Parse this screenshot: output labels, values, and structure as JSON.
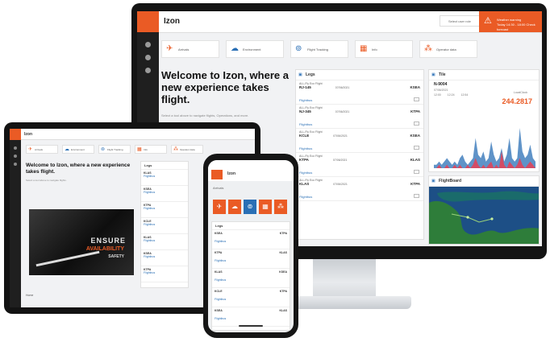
{
  "desktop": {
    "app_title": "Izon",
    "header_select": "Select user role",
    "alert": {
      "line1": "Weather warning",
      "line2": "Today 14:30 - 18:00 Check forecast"
    },
    "quick_actions": [
      {
        "label": "Arrivals",
        "icon": "plane-arrival-icon",
        "glyph": "✈",
        "color": "#ea5b25"
      },
      {
        "label": "Environment",
        "icon": "cloud-icon",
        "glyph": "☁",
        "color": "#2a6fb5"
      },
      {
        "label": "Flight Tracking",
        "icon": "satellite-icon",
        "glyph": "⊚",
        "color": "#2a6fb5"
      },
      {
        "label": "Info",
        "icon": "info-board-icon",
        "glyph": "▦",
        "color": "#ea5b25"
      },
      {
        "label": "Operator data",
        "icon": "network-icon",
        "glyph": "⁂",
        "color": "#ea5b25"
      }
    ],
    "welcome_heading": "Welcome to Izon, where a new experience takes flight.",
    "welcome_text": "Select a tool above to navigate flights, Operations, and more.",
    "legs_panel": {
      "title": "Legs",
      "rows": [
        {
          "code": "ALL-Fly Eco Flight",
          "flight": "RJ-145",
          "time": "07/06/2021",
          "dest": "KSEA",
          "status": "Flightbus"
        },
        {
          "code": "ALL-Fly Eco Flight",
          "flight": "NJ-345",
          "time": "07/06/2021",
          "dest": "KTPA",
          "status": "Flightbus"
        },
        {
          "code": "ALL-Fly Eco Flight",
          "flight": "KCLE",
          "time": "07/06/2021",
          "dest": "KSEA",
          "status": "Flightbus"
        },
        {
          "code": "ALL-Fly Eco Flight",
          "flight": "KTPA",
          "time": "07/06/2021",
          "dest": "KLAS",
          "status": "Flightbus"
        },
        {
          "code": "ALL-Fly Eco Flight",
          "flight": "KLAS",
          "time": "07/06/2021",
          "dest": "KTPA",
          "status": "Flightbus"
        }
      ]
    },
    "tile_panel": {
      "title": "Tile",
      "route": "N-9004",
      "date": "07/06/2021",
      "date_label": "LocalClock",
      "kpi": "244.2817",
      "times": [
        "12:00",
        "12:24",
        "12:54"
      ]
    },
    "map_panel": {
      "title": "FlightBoard"
    },
    "chart_data": {
      "type": "area",
      "series": [
        {
          "values": [
            1,
            1,
            2,
            1,
            2,
            3,
            2,
            1,
            2,
            1,
            3,
            4,
            2,
            1,
            2,
            3,
            9,
            4,
            3,
            5,
            2,
            3,
            8,
            4,
            2,
            3,
            6,
            2,
            4,
            9,
            3,
            2,
            3,
            12,
            5,
            3,
            4,
            7,
            3,
            2
          ],
          "color": "#2a6fb5"
        },
        {
          "values": [
            0,
            0,
            1,
            0,
            0,
            1,
            0,
            0,
            1,
            0,
            1,
            0,
            0,
            1,
            0,
            1,
            3,
            1,
            0,
            1,
            0,
            1,
            2,
            0,
            1,
            0,
            5,
            1,
            0,
            2,
            1,
            0,
            1,
            3,
            1,
            0,
            1,
            2,
            1,
            0
          ],
          "color": "#e0455a"
        }
      ]
    }
  },
  "tablet": {
    "app_title": "Izon",
    "quick_actions": [
      {
        "label": "Arrivals",
        "glyph": "✈",
        "color": "#ea5b25"
      },
      {
        "label": "Environment",
        "glyph": "☁",
        "color": "#2a6fb5"
      },
      {
        "label": "Flight Tracking",
        "glyph": "⊚",
        "color": "#2a6fb5"
      },
      {
        "label": "Info",
        "glyph": "▦",
        "color": "#ea5b25"
      },
      {
        "label": "Operator data",
        "glyph": "⁂",
        "color": "#ea5b25"
      }
    ],
    "welcome_heading": "Welcome to Izon, where a new experience takes flight.",
    "welcome_text": "Select a tool above to navigate flights.",
    "video_title": "ENSURE",
    "video_line1": "AVAILABILITY",
    "video_line2": "SAFETY",
    "legs_title": "Legs",
    "footer": "Home",
    "rows": [
      {
        "flight": "KLAS",
        "status": "Flightbus"
      },
      {
        "flight": "KSEA",
        "status": "Flightbus"
      },
      {
        "flight": "KTPA",
        "status": "Flightbus"
      },
      {
        "flight": "KCLE",
        "status": "Flightbus"
      },
      {
        "flight": "KLAS",
        "status": "Flightbus"
      },
      {
        "flight": "KSEA",
        "status": "Flightbus"
      },
      {
        "flight": "KTPA",
        "status": "Flightbus"
      }
    ]
  },
  "phone": {
    "app_title": "Izon",
    "subtitle": "Arrivals",
    "tiles": [
      {
        "glyph": "✈",
        "color": "#ea5b25"
      },
      {
        "glyph": "☁",
        "color": "#ea5b25"
      },
      {
        "glyph": "⊚",
        "color": "#2a6fb5"
      },
      {
        "glyph": "▦",
        "color": "#ea5b25"
      },
      {
        "glyph": "⁂",
        "color": "#ea5b25"
      }
    ],
    "legs_title": "Legs",
    "rows": [
      {
        "flight": "KSEA",
        "dest": "KTPA",
        "status": "Flightbus"
      },
      {
        "flight": "KTPA",
        "dest": "KLAS",
        "status": "Flightbus"
      },
      {
        "flight": "KLAS",
        "dest": "KSEA",
        "status": "Flightbus"
      },
      {
        "flight": "KCLE",
        "dest": "KTPA",
        "status": "Flightbus"
      },
      {
        "flight": "KSEA",
        "dest": "KLAS",
        "status": "Flightbus"
      }
    ]
  }
}
